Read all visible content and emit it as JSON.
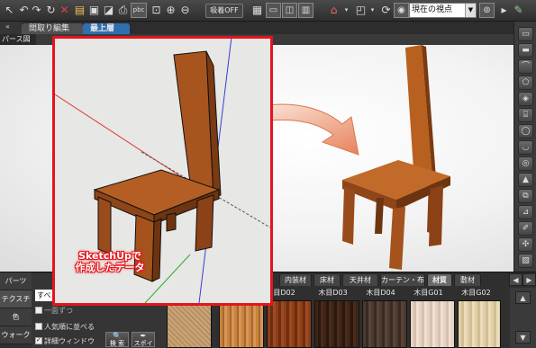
{
  "toolbar": {
    "snap_label": "吸着OFF",
    "view_select": "現在の視点",
    "pbc": "pbc"
  },
  "tabs": {
    "layout_edit": "間取り編集",
    "top_floor": "最上層"
  },
  "view": {
    "perspective_label": "パース図"
  },
  "overlay": {
    "line1": "SketchUpで",
    "line2": "作成したデータ"
  },
  "left_tabs": [
    "パーツ",
    "テクスチャ",
    "色",
    "ウォーク"
  ],
  "options": {
    "all_tab": "すべ",
    "opt1": "一面ずつ",
    "opt2": "人気順に並べる",
    "opt3": "詳細ウィンドウ",
    "search": "検 索",
    "eyedropper": "スポイト"
  },
  "category_tabs": [
    "内装材",
    "床材",
    "天井材",
    "カーテン・布",
    "材質",
    "敷材"
  ],
  "selected_category": "材質",
  "texture_names": [
    "木目D02",
    "木目D03",
    "木目D04",
    "木目G01",
    "木目G02"
  ],
  "colors": {
    "highlight_red": "#e5141c",
    "accent_blue": "#2f6fb0",
    "wood": "#a8541f"
  }
}
